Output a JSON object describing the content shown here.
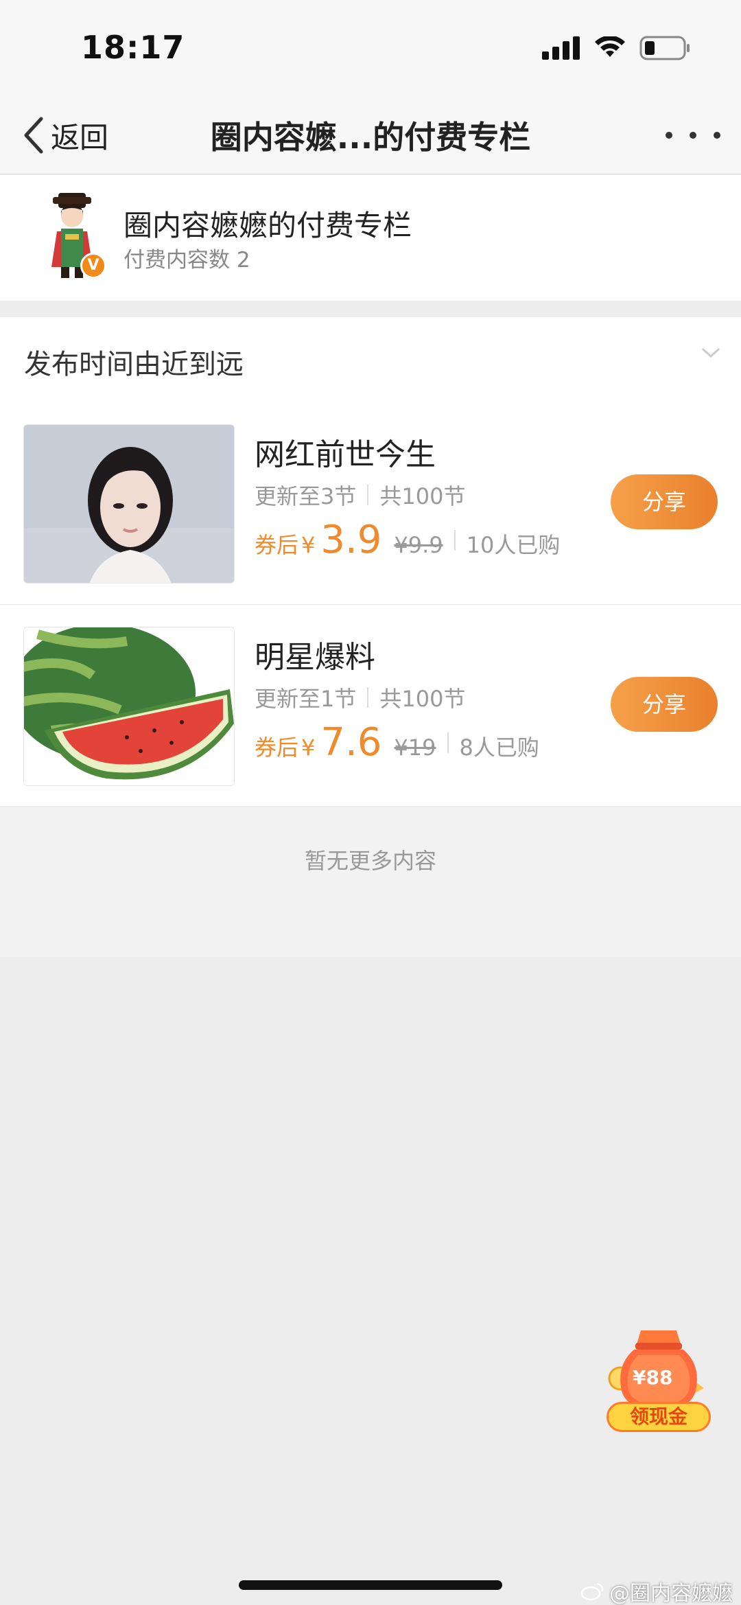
{
  "status_bar": {
    "time": "18:17"
  },
  "nav": {
    "back_label": "返回",
    "title": "圈内容嬷...的付费专栏"
  },
  "header": {
    "title": "圈内容嬷嬷的付费专栏",
    "subtitle": "付费内容数 2",
    "badge": "V"
  },
  "sort": {
    "label": "发布时间由近到远"
  },
  "items": [
    {
      "title": "网红前世今生",
      "updated": "更新至3节",
      "total": "共100节",
      "price_prefix": "券后",
      "currency": "¥",
      "price": "3.9",
      "original_price": "¥9.9",
      "bought": "10人已购",
      "share_label": "分享"
    },
    {
      "title": "明星爆料",
      "updated": "更新至1节",
      "total": "共100节",
      "price_prefix": "券后",
      "currency": "¥",
      "price": "7.6",
      "original_price": "¥19",
      "bought": "8人已购",
      "share_label": "分享"
    }
  ],
  "no_more": "暂无更多内容",
  "floating_coupon": {
    "amount": "¥88",
    "label": "领现金"
  },
  "watermark": "@圈内容嬷嬷",
  "colors": {
    "accent": "#f08a2a",
    "background": "#ededed"
  }
}
